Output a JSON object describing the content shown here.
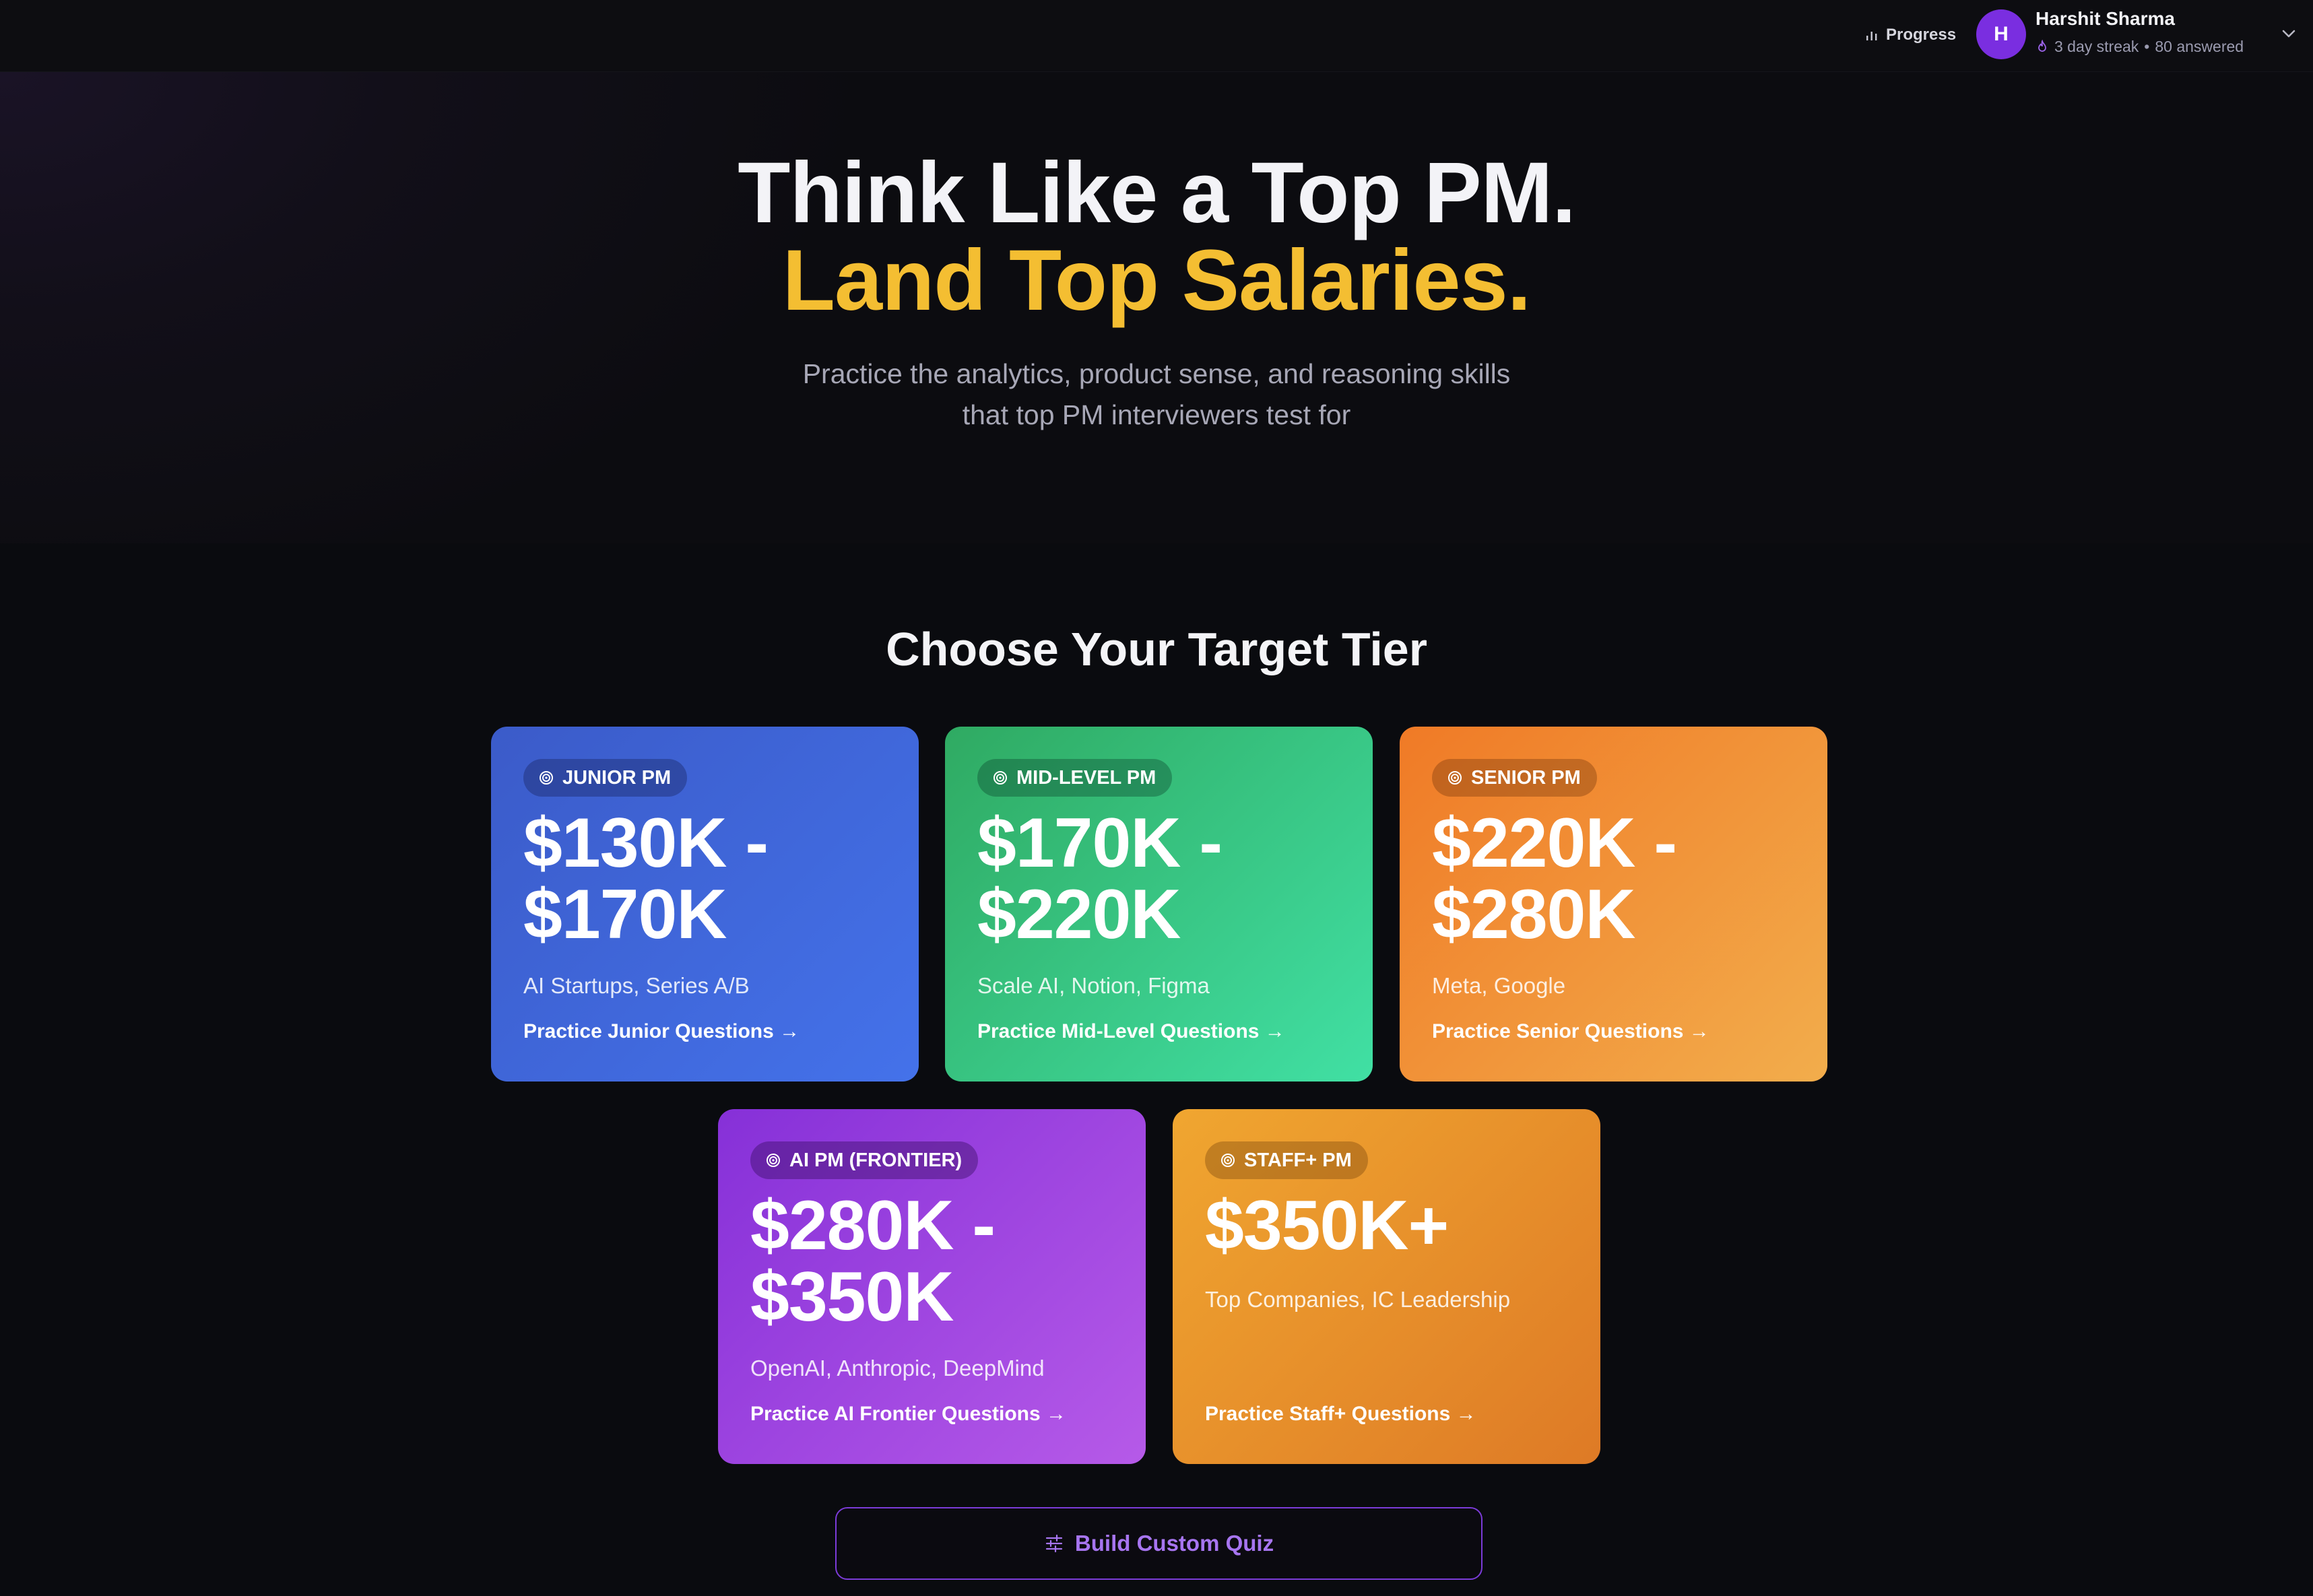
{
  "header": {
    "progress_label": "Progress",
    "avatar_initial": "H",
    "user_name": "Harshit Sharma",
    "streak_text": "3 day streak",
    "separator": "•",
    "answered_text": "80 answered",
    "icons": [
      "bar-chart-icon",
      "flame-icon",
      "chevron-down-icon"
    ]
  },
  "hero": {
    "title_line1": "Think Like a Top PM.",
    "title_line2": "Land Top Salaries.",
    "subtitle_line1": "Practice the analytics, product sense, and reasoning skills",
    "subtitle_line2": "that top PM interviewers test for"
  },
  "tiers": {
    "title": "Choose Your Target Tier",
    "items": [
      {
        "badge": "JUNIOR PM",
        "price_line1": "$130K -",
        "price_line2": "$170K",
        "companies": "AI Startups, Series A/B",
        "cta": "Practice Junior Questions →",
        "color": "#4472ea"
      },
      {
        "badge": "MID-LEVEL PM",
        "price_line1": "$170K -",
        "price_line2": "$220K",
        "companies": "Scale AI, Notion, Figma",
        "cta": "Practice Mid-Level Questions →",
        "color": "#41e0a4"
      },
      {
        "badge": "SENIOR PM",
        "price_line1": "$220K -",
        "price_line2": "$280K",
        "companies": "Meta, Google",
        "cta": "Practice Senior Questions →",
        "color": "#f2ad4c"
      },
      {
        "badge": "AI PM (FRONTIER)",
        "price_line1": "$280K -",
        "price_line2": "$350K",
        "companies": "OpenAI, Anthropic, DeepMind",
        "cta": "Practice AI Frontier Questions →",
        "color": "#b65ae8"
      },
      {
        "badge": "STAFF+ PM",
        "price_line1": "$350K+",
        "companies": "Top Companies, IC Leadership",
        "cta": "Practice Staff+ Questions →",
        "color": "#de7a26"
      }
    ]
  },
  "custom_quiz": {
    "label": "Build Custom Quiz",
    "icon": "sliders-icon",
    "accent": "#7b3bd8"
  }
}
